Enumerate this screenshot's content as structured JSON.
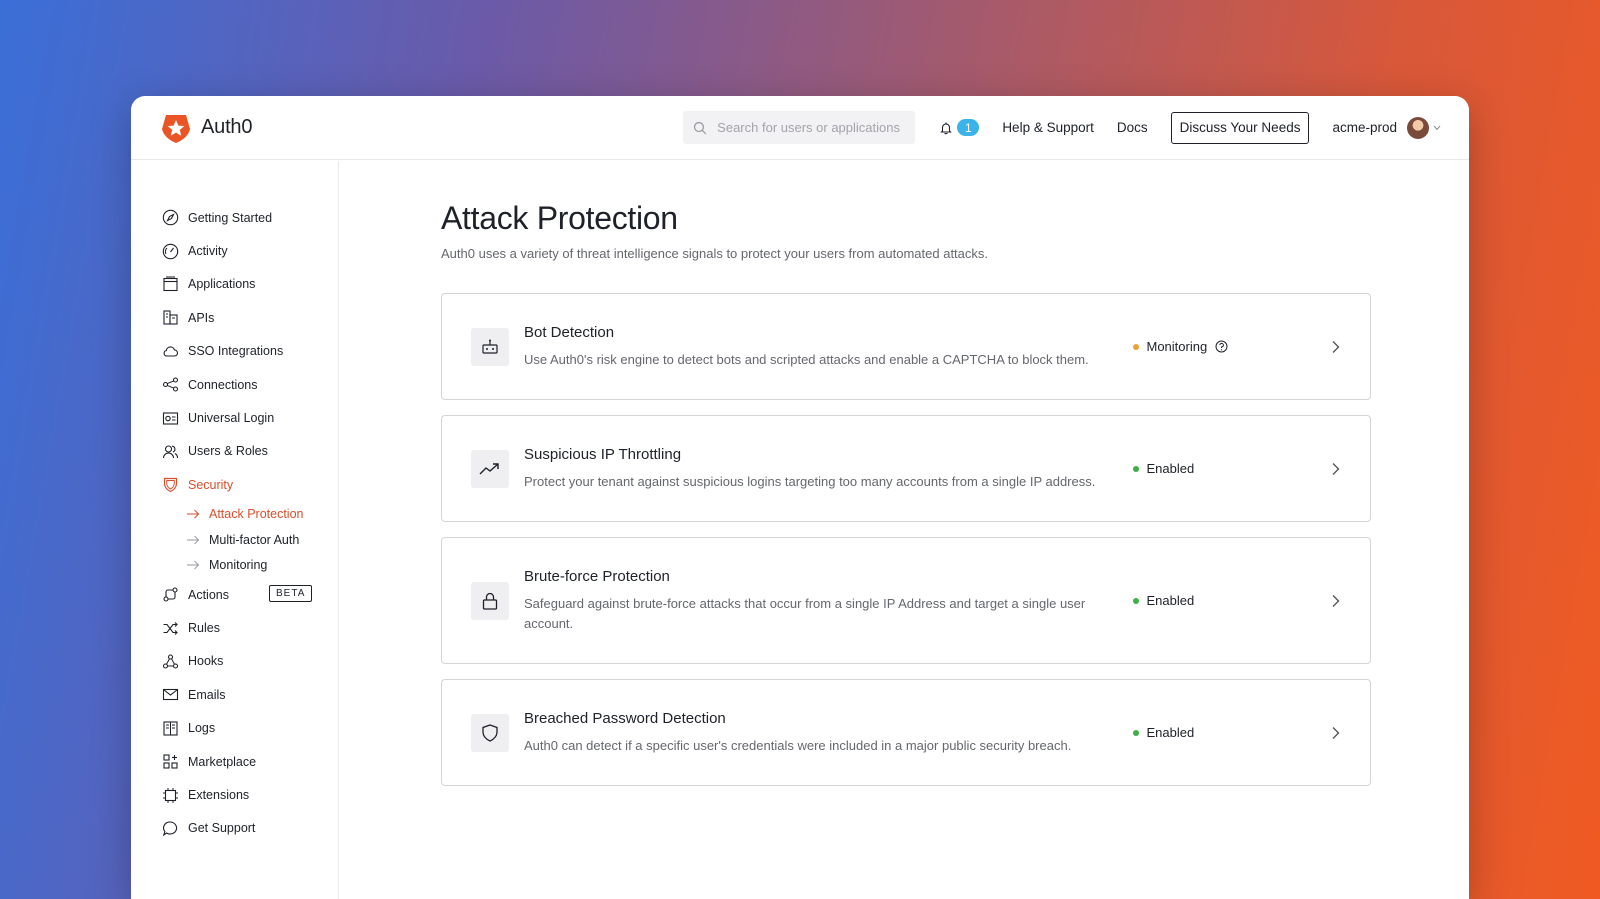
{
  "brand": {
    "name": "Auth0",
    "accent": "#d94e2b"
  },
  "search": {
    "placeholder": "Search for users or applications"
  },
  "notifications": {
    "count": "1"
  },
  "header": {
    "help_label": "Help & Support",
    "docs_label": "Docs",
    "discuss_label": "Discuss Your Needs",
    "tenant": "acme-prod"
  },
  "sidebar": {
    "items": [
      {
        "label": "Getting Started",
        "icon": "compass-icon"
      },
      {
        "label": "Activity",
        "icon": "gauge-icon"
      },
      {
        "label": "Applications",
        "icon": "window-icon"
      },
      {
        "label": "APIs",
        "icon": "building-icon"
      },
      {
        "label": "SSO Integrations",
        "icon": "cloud-icon"
      },
      {
        "label": "Connections",
        "icon": "share-icon"
      },
      {
        "label": "Universal Login",
        "icon": "id-card-icon"
      },
      {
        "label": "Users & Roles",
        "icon": "users-icon"
      },
      {
        "label": "Security",
        "icon": "shield-icon",
        "active": true
      },
      {
        "label": "Actions",
        "icon": "flow-icon",
        "badge": "BETA"
      },
      {
        "label": "Rules",
        "icon": "shuffle-icon"
      },
      {
        "label": "Hooks",
        "icon": "hook-icon"
      },
      {
        "label": "Emails",
        "icon": "mail-icon"
      },
      {
        "label": "Logs",
        "icon": "book-icon"
      },
      {
        "label": "Marketplace",
        "icon": "grid-plus-icon"
      },
      {
        "label": "Extensions",
        "icon": "chip-icon"
      },
      {
        "label": "Get Support",
        "icon": "chat-icon"
      }
    ],
    "security_sub": [
      {
        "label": "Attack Protection",
        "active": true
      },
      {
        "label": "Multi-factor Auth"
      },
      {
        "label": "Monitoring"
      }
    ]
  },
  "main": {
    "title": "Attack Protection",
    "subtitle": "Auth0 uses a variety of threat intelligence signals to protect your users from automated attacks.",
    "cards": [
      {
        "title": "Bot Detection",
        "description": "Use Auth0's risk engine to detect bots and scripted attacks and enable a CAPTCHA to block them.",
        "status": "Monitoring",
        "status_color": "#f0a030",
        "icon": "robot-icon"
      },
      {
        "title": "Suspicious IP Throttling",
        "description": "Protect your tenant against suspicious logins targeting too many accounts from a single IP address.",
        "status": "Enabled",
        "status_color": "#3cb043",
        "icon": "trend-up-icon"
      },
      {
        "title": "Brute-force Protection",
        "description": "Safeguard against brute-force attacks that occur from a single IP Address and target a single user account.",
        "status": "Enabled",
        "status_color": "#3cb043",
        "icon": "lock-icon"
      },
      {
        "title": "Breached Password Detection",
        "description": "Auth0 can detect if a specific user's credentials were included in a major public security breach.",
        "status": "Enabled",
        "status_color": "#3cb043",
        "icon": "shield-icon"
      }
    ]
  }
}
